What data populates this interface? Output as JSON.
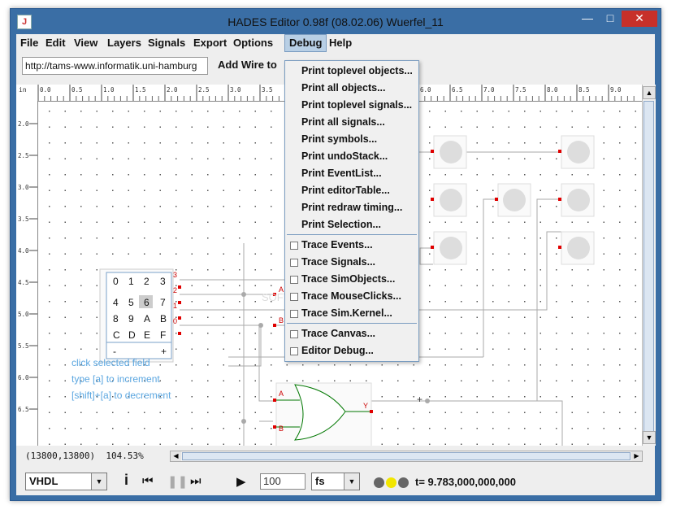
{
  "window": {
    "title": "HADES Editor 0.98f (08.02.06)   Wuerfel_11",
    "icon": "java-icon",
    "controls": [
      "minimize-icon",
      "maximize-icon",
      "close-icon"
    ]
  },
  "menubar": {
    "items": [
      "File",
      "Edit",
      "View",
      "Layers",
      "Signals",
      "Export",
      "Options",
      "Debug",
      "Help"
    ],
    "active": "Debug"
  },
  "toolbar": {
    "url": "http://tams-www.informatik.uni-hamburg",
    "add_wire": "Add Wire to"
  },
  "ruler": {
    "corner": "in",
    "top_ticks": [
      "0.0",
      "0.5",
      "1.0",
      "1.5",
      "2.0",
      "2.5",
      "3.0",
      "3.5",
      "6.0",
      "6.5",
      "7.0",
      "7.5",
      "8.0",
      "8.5",
      "9.0"
    ],
    "left_ticks": [
      "2.0",
      "2.5",
      "3.0",
      "3.5",
      "4.0",
      "4.5",
      "5.0",
      "5.5",
      "6.0",
      "6.5"
    ]
  },
  "debug_menu": {
    "section1": [
      "Print toplevel objects...",
      "Print all objects...",
      "Print toplevel signals...",
      "Print all signals...",
      "Print symbols...",
      "Print undoStack...",
      "Print EventList...",
      "Print editorTable...",
      "Print redraw timing...",
      "Print Selection..."
    ],
    "section2": [
      "Trace Events...",
      "Trace Signals...",
      "Trace SimObjects...",
      "Trace MouseClicks...",
      "Trace Sim.Kernel..."
    ],
    "section3_checkbox": [
      "Trace Canvas..."
    ],
    "section3_plain": [
      "Editor Debug..."
    ]
  },
  "hex_switch": {
    "rows": [
      [
        "0",
        "1",
        "2",
        "3"
      ],
      [
        "4",
        "5",
        "6",
        "7"
      ],
      [
        "8",
        "9",
        "A",
        "B"
      ],
      [
        "C",
        "D",
        "E",
        "F"
      ]
    ],
    "selected": "6",
    "minus": "-",
    "plus": "+",
    "bit_labels": [
      "3",
      "2",
      "1",
      "0"
    ]
  },
  "or_gate": {
    "inputs": [
      "A",
      "B"
    ],
    "output": "Y"
  },
  "mux_labels": [
    "A",
    "B"
  ],
  "watermark": "SOFTPEDIA",
  "instructions": [
    "click selected field",
    "type [a] to increment",
    "[shift]+[a] to decrement"
  ],
  "status": {
    "coords": "(13800,13800)",
    "zoom": "104.53%"
  },
  "controls": {
    "language": "VHDL",
    "info_icon": "info-icon",
    "speed_value": "100",
    "time_unit": "fs",
    "sim_state_colors": [
      "#666666",
      "#f2e600",
      "#666666"
    ],
    "sim_time": "t= 9.783,000,000,000"
  }
}
